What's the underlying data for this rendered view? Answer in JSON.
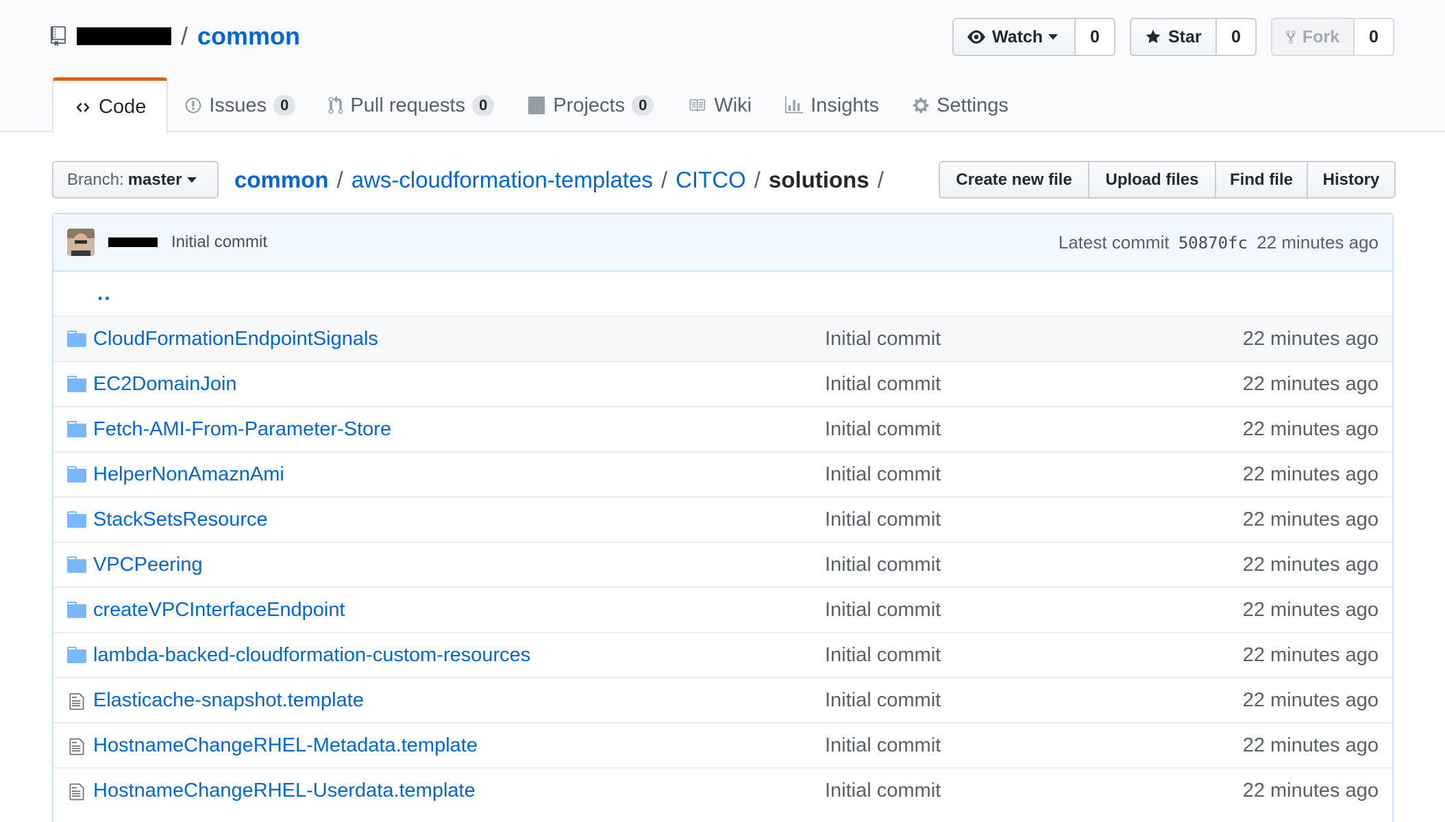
{
  "repo": {
    "owner_redacted": true,
    "separator": "/",
    "name": "common"
  },
  "header_actions": {
    "watch": {
      "label": "Watch",
      "count": "0",
      "icon": "eye-icon"
    },
    "star": {
      "label": "Star",
      "count": "0",
      "icon": "star-icon"
    },
    "fork": {
      "label": "Fork",
      "count": "0",
      "icon": "fork-icon"
    }
  },
  "tabs": [
    {
      "label": "Code",
      "icon": "code-icon",
      "selected": true
    },
    {
      "label": "Issues",
      "icon": "issue-icon",
      "counter": "0"
    },
    {
      "label": "Pull requests",
      "icon": "pull-request-icon",
      "counter": "0"
    },
    {
      "label": "Projects",
      "icon": "project-icon",
      "counter": "0"
    },
    {
      "label": "Wiki",
      "icon": "book-icon"
    },
    {
      "label": "Insights",
      "icon": "graph-icon"
    },
    {
      "label": "Settings",
      "icon": "gear-icon"
    }
  ],
  "branch": {
    "label": "Branch:",
    "value": "master"
  },
  "breadcrumb": {
    "root": "common",
    "sep1": "/",
    "p1": "aws-cloudformation-templates",
    "sep2": "/",
    "p2": "CITCO",
    "sep3": "/",
    "current": "solutions",
    "sep4": "/"
  },
  "file_actions": {
    "create": "Create new file",
    "upload": "Upload files",
    "find": "Find file",
    "history": "History"
  },
  "commit": {
    "message": "Initial commit",
    "latest_label": "Latest commit",
    "sha": "50870fc",
    "age": "22 minutes ago"
  },
  "up_dir": "..",
  "files": [
    {
      "type": "dir",
      "name": "CloudFormationEndpointSignals",
      "message": "Initial commit",
      "age": "22 minutes ago"
    },
    {
      "type": "dir",
      "name": "EC2DomainJoin",
      "message": "Initial commit",
      "age": "22 minutes ago"
    },
    {
      "type": "dir",
      "name": "Fetch-AMI-From-Parameter-Store",
      "message": "Initial commit",
      "age": "22 minutes ago"
    },
    {
      "type": "dir",
      "name": "HelperNonAmaznAmi",
      "message": "Initial commit",
      "age": "22 minutes ago"
    },
    {
      "type": "dir",
      "name": "StackSetsResource",
      "message": "Initial commit",
      "age": "22 minutes ago"
    },
    {
      "type": "dir",
      "name": "VPCPeering",
      "message": "Initial commit",
      "age": "22 minutes ago"
    },
    {
      "type": "dir",
      "name": "createVPCInterfaceEndpoint",
      "message": "Initial commit",
      "age": "22 minutes ago"
    },
    {
      "type": "dir",
      "name": "lambda-backed-cloudformation-custom-resources",
      "message": "Initial commit",
      "age": "22 minutes ago"
    },
    {
      "type": "file",
      "name": "Elasticache-snapshot.template",
      "message": "Initial commit",
      "age": "22 minutes ago"
    },
    {
      "type": "file",
      "name": "HostnameChangeRHEL-Metadata.template",
      "message": "Initial commit",
      "age": "22 minutes ago"
    },
    {
      "type": "file",
      "name": "HostnameChangeRHEL-Userdata.template",
      "message": "Initial commit",
      "age": "22 minutes ago"
    }
  ],
  "colors": {
    "link": "#0366d6",
    "tab_accent": "#e36209",
    "commit_bg": "#f1f8ff",
    "folder": "#79b8ff"
  }
}
